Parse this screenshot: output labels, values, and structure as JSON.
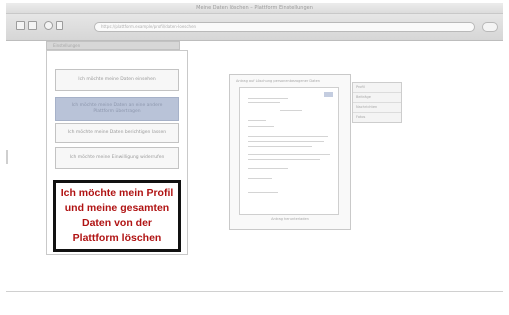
{
  "window": {
    "title": "Meine Daten löschen – Plattform Einstellungen"
  },
  "toolbar": {
    "url": "https://plattform.example/profil/daten-loeschen",
    "buttons": [
      "back-icon",
      "forward-icon",
      "add-icon",
      "sidebar-icon"
    ]
  },
  "tabs": {
    "label": "Einstellungen"
  },
  "options": [
    {
      "label": "Ich möchte meine Daten einsehen"
    },
    {
      "label": "Ich möchte meine Daten an eine andere Plattform übertragen"
    },
    {
      "label": "Ich möchte meine Daten berichtigen lassen"
    },
    {
      "label": "Ich möchte meine Einwilligung widerrufen"
    }
  ],
  "callout": {
    "text": "Ich möchte mein Profil\nund meine gesamten\nDaten von der\nPlattform löschen",
    "color": "#b01313"
  },
  "document": {
    "header": "Antrag auf Löschung personenbezogener Daten",
    "footer": "Antrag herunterladen"
  },
  "mini_table": {
    "rows": [
      "Profil",
      "Beiträge",
      "Nachrichten",
      "Fotos"
    ]
  }
}
